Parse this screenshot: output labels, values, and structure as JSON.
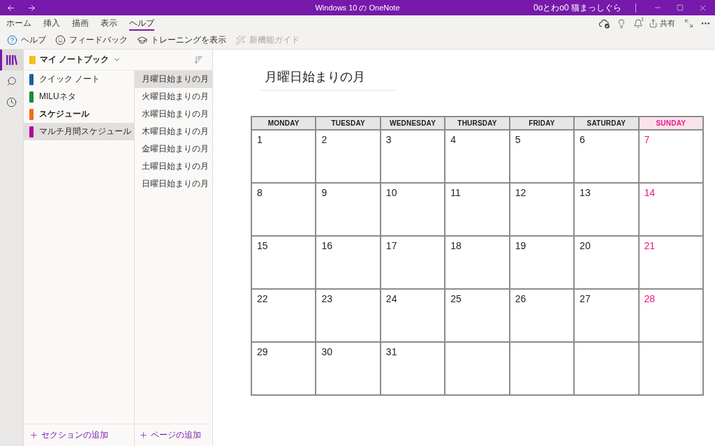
{
  "window": {
    "title": "Windows 10 の OneNote",
    "user": "0oとわo0 猫まっしぐら"
  },
  "ribbon": {
    "tabs": [
      {
        "label": "ホーム",
        "selected": false
      },
      {
        "label": "挿入",
        "selected": false
      },
      {
        "label": "描画",
        "selected": false
      },
      {
        "label": "表示",
        "selected": false
      },
      {
        "label": "ヘルプ",
        "selected": true
      }
    ],
    "notification_count": "1",
    "share_label": "共有",
    "commands": [
      {
        "kind": "help",
        "label": "ヘルプ",
        "disabled": false
      },
      {
        "kind": "feedback",
        "label": "フィードバック",
        "disabled": false
      },
      {
        "kind": "training",
        "label": "トレーニングを表示",
        "disabled": false
      },
      {
        "kind": "guide",
        "label": "新機能ガイド",
        "disabled": true
      }
    ]
  },
  "nav": [
    {
      "kind": "notebooks",
      "selected": true
    },
    {
      "kind": "search",
      "selected": false
    },
    {
      "kind": "recent",
      "selected": false
    }
  ],
  "notebook": {
    "name": "マイ ノートブック",
    "sections": [
      {
        "name": "クイック ノート",
        "color": "#1f5aa6",
        "selected": false,
        "bold": false
      },
      {
        "name": "MILUネタ",
        "color": "#188a3c",
        "selected": false,
        "bold": false
      },
      {
        "name": "スケジュール",
        "color": "#f56b13",
        "selected": false,
        "bold": true
      },
      {
        "name": "マルチ月間スケジュール",
        "color": "#b4009e",
        "selected": true,
        "bold": false
      }
    ],
    "pages": [
      {
        "title": "月曜日始まりの月",
        "selected": true
      },
      {
        "title": "火曜日始まりの月",
        "selected": false
      },
      {
        "title": "水曜日始まりの月",
        "selected": false
      },
      {
        "title": "木曜日始まりの月",
        "selected": false
      },
      {
        "title": "金曜日始まりの月",
        "selected": false
      },
      {
        "title": "土曜日始まりの月",
        "selected": false
      },
      {
        "title": "日曜日始まりの月",
        "selected": false
      }
    ],
    "add_section": "セクションの追加",
    "add_page": "ページの追加"
  },
  "page": {
    "title": "月曜日始まりの月",
    "calendar": {
      "columns": [
        {
          "label": "MONDAY",
          "highlight": false
        },
        {
          "label": "TUESDAY",
          "highlight": false
        },
        {
          "label": "WEDNESDAY",
          "highlight": false
        },
        {
          "label": "THURSDAY",
          "highlight": false
        },
        {
          "label": "FRIDAY",
          "highlight": false
        },
        {
          "label": "SATURDAY",
          "highlight": false
        },
        {
          "label": "SUNDAY",
          "highlight": true
        }
      ],
      "weeks": [
        [
          "1",
          "2",
          "3",
          "4",
          "5",
          "6",
          "7"
        ],
        [
          "8",
          "9",
          "10",
          "11",
          "12",
          "13",
          "14"
        ],
        [
          "15",
          "16",
          "17",
          "18",
          "19",
          "20",
          "21"
        ],
        [
          "22",
          "23",
          "24",
          "25",
          "26",
          "27",
          "28"
        ],
        [
          "29",
          "30",
          "31"
        ]
      ]
    }
  }
}
